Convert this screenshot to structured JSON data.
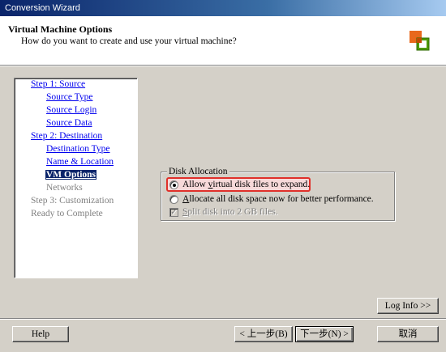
{
  "window": {
    "title": "Conversion Wizard"
  },
  "header": {
    "title": "Virtual Machine Options",
    "subtitle": "How do you want to create and use your virtual machine?"
  },
  "steps": [
    {
      "label": "Step 1: Source",
      "state": "link"
    },
    {
      "label": "Source Type",
      "state": "link"
    },
    {
      "label": "Source Login",
      "state": "link"
    },
    {
      "label": "Source Data",
      "state": "link"
    },
    {
      "label": "Step 2: Destination",
      "state": "link"
    },
    {
      "label": "Destination Type",
      "state": "link"
    },
    {
      "label": "Name & Location",
      "state": "link"
    },
    {
      "label": "VM Options",
      "state": "current"
    },
    {
      "label": "Networks",
      "state": "disabled"
    },
    {
      "label": "Step 3: Customization",
      "state": "disabled"
    },
    {
      "label": "Ready to Complete",
      "state": "disabled"
    }
  ],
  "disk_allocation": {
    "group_title": "Disk Allocation",
    "options": [
      {
        "pre": "Allow ",
        "accel": "v",
        "post": "irtual disk files to expand.",
        "selected": true
      },
      {
        "pre": "",
        "accel": "A",
        "post": "llocate all disk space now for better performance.",
        "selected": false
      }
    ],
    "split": {
      "pre": "",
      "accel": "S",
      "post": "plit disk into 2 GB files.",
      "checked": true,
      "enabled": false
    }
  },
  "buttons": {
    "log_info": "Log Info >>",
    "help": "Help",
    "back": "< 上一步(B)",
    "next": "下一步(N) >",
    "cancel": "取消"
  },
  "colors": {
    "highlight_border": "#e0302a",
    "title_bar": "#0a246a",
    "link": "#0000ee"
  }
}
